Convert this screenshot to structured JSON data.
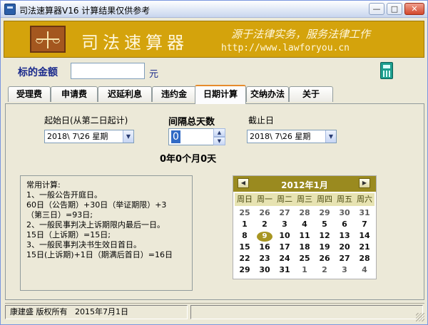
{
  "window": {
    "title": "司法速算器V16  计算结果仅供参考",
    "minimize": "—",
    "maximize": "□",
    "close": "✕"
  },
  "banner": {
    "name": "司法速算器",
    "slogan": "源于法律实务，服务法律工作",
    "url": "http://www.lawforyou.cn"
  },
  "amount": {
    "label": "标的金额",
    "value": "",
    "unit": "元"
  },
  "icons": {
    "app": "app-icon",
    "logo": "scale-logo-icon",
    "calculator": "calculator-icon"
  },
  "tabs": [
    {
      "label": "受理费"
    },
    {
      "label": "申请费"
    },
    {
      "label": "迟延利息"
    },
    {
      "label": "违约金"
    },
    {
      "label": "日期计算"
    },
    {
      "label": "交纳办法"
    },
    {
      "label": "关于"
    }
  ],
  "active_tab": "日期计算",
  "date_calc": {
    "start_label": "起始日(从第二日起计)",
    "start_value": "2018\\  7\\26  星期",
    "interval_label": "间隔总天数",
    "interval_value": "0",
    "end_label": "截止日",
    "end_value": "2018\\  7\\26  星期",
    "result": "0年0个月0天"
  },
  "notes": [
    "常用计算:",
    "1、一般公告开庭日。",
    " 60日（公告期）+30日（举证期限）+3",
    "（第三日）=93日;",
    "2、一般民事判决上诉期限内最后一日。",
    " 15日（上诉期）=15日;",
    "3、一般民事判决书生效日首日。",
    " 15日(上诉期)+1日（期满后首日）=16日"
  ],
  "calendar": {
    "title": "2012年1月",
    "prev": "◀",
    "next": "▶",
    "weekdays": [
      "周日",
      "周一",
      "周二",
      "周三",
      "周四",
      "周五",
      "周六"
    ],
    "selected_day": "9",
    "weeks": [
      [
        "25",
        "26",
        "27",
        "28",
        "29",
        "30",
        "31"
      ],
      [
        "1",
        "2",
        "3",
        "4",
        "5",
        "6",
        "7"
      ],
      [
        "8",
        "9",
        "10",
        "11",
        "12",
        "13",
        "14"
      ],
      [
        "15",
        "16",
        "17",
        "18",
        "19",
        "20",
        "21"
      ],
      [
        "22",
        "23",
        "24",
        "25",
        "26",
        "27",
        "28"
      ],
      [
        "29",
        "30",
        "31",
        "1",
        "2",
        "3",
        "4"
      ]
    ]
  },
  "status": {
    "author": "康建盛  版权所有",
    "date": "2015年7月1日"
  },
  "colors": {
    "banner": "#d4a30c",
    "accent_tab": "#e68b2c",
    "calendar_header": "#9a8a1f"
  }
}
